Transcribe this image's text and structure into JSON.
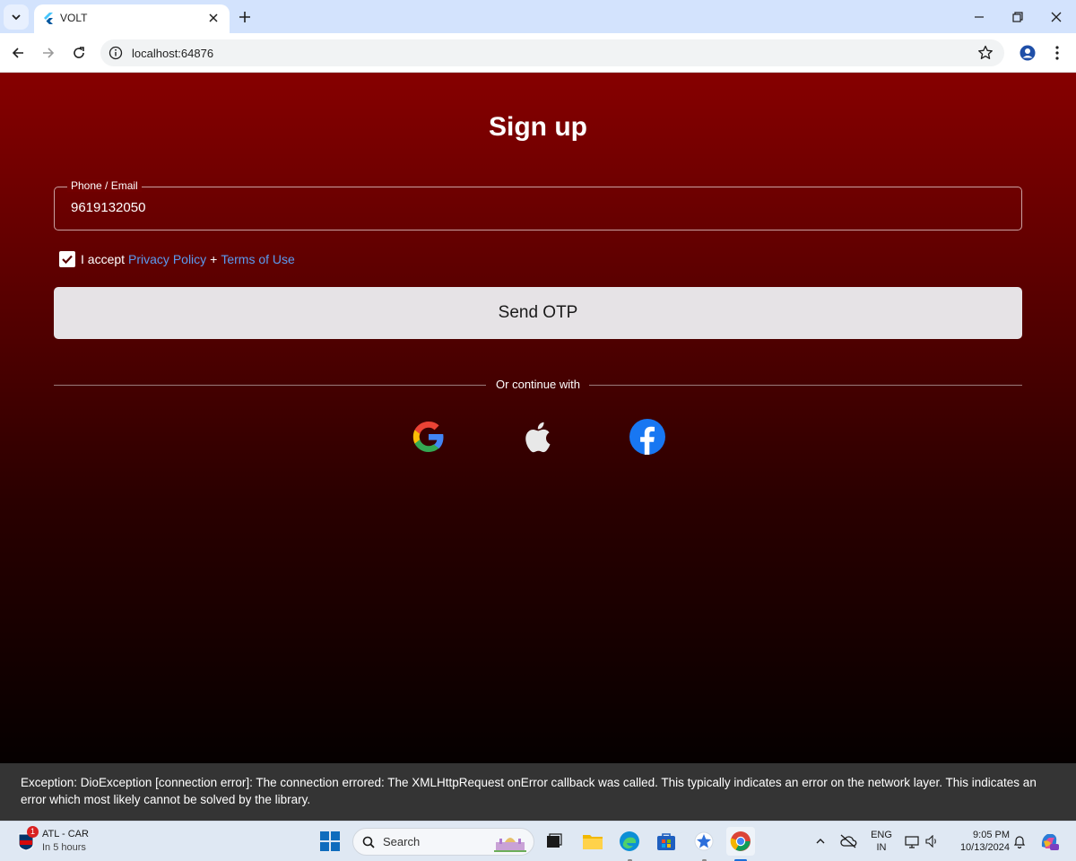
{
  "browser": {
    "tab_title": "VOLT",
    "url": "localhost:64876"
  },
  "page": {
    "title": "Sign up",
    "phone_field": {
      "label": "Phone / Email",
      "value": "9619132050"
    },
    "accept": {
      "checked": true,
      "prefix": "I accept",
      "privacy_link": "Privacy Policy",
      "plus": "+",
      "terms_link": "Terms of Use"
    },
    "send_otp_label": "Send OTP",
    "divider_text": "Or continue with",
    "social": [
      {
        "icon": "google-icon"
      },
      {
        "icon": "apple-icon"
      },
      {
        "icon": "facebook-icon"
      }
    ]
  },
  "error": {
    "message": "Exception: DioException [connection error]: The connection errored: The XMLHttpRequest onError callback was called. This typically indicates an error on the network layer. This indicates an error which most likely cannot be solved by the library."
  },
  "taskbar": {
    "widget_title": "ATL - CAR",
    "widget_sub": "In 5 hours",
    "widget_badge": "1",
    "search_placeholder": "Search",
    "lang_line1": "ENG",
    "lang_line2": "IN",
    "time": "9:05 PM",
    "date": "10/13/2024"
  },
  "colors": {
    "bg_top": "#860000",
    "bg_bottom": "#050000",
    "link": "#5b9bf0",
    "button_bg": "#e6e3e6"
  }
}
